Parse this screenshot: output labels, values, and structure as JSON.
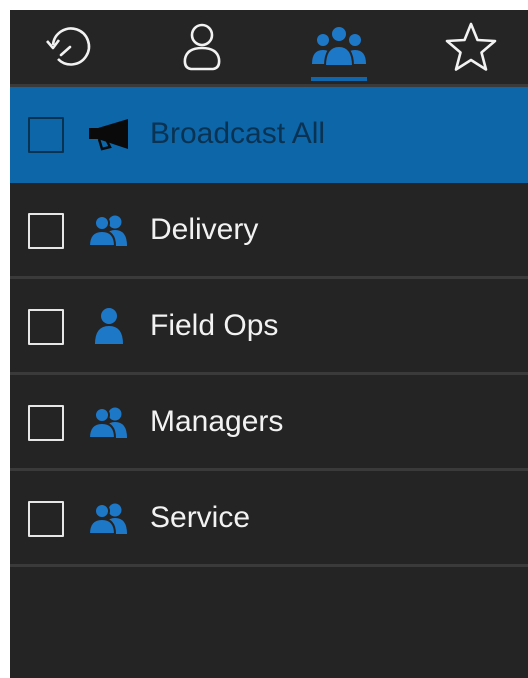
{
  "tabs": [
    {
      "icon": "history-icon",
      "label": "",
      "active": false
    },
    {
      "icon": "contact-icon",
      "label": "",
      "active": false
    },
    {
      "icon": "groups-icon",
      "label": "",
      "active": true
    },
    {
      "icon": "favorites-star-icon",
      "label": "",
      "active": false
    }
  ],
  "list": {
    "items": [
      {
        "label": "Broadcast All",
        "icon": "megaphone-icon",
        "checked": false,
        "selected": true
      },
      {
        "label": "Delivery",
        "icon": "group-icon",
        "checked": false,
        "selected": false
      },
      {
        "label": "Field Ops",
        "icon": "person-icon",
        "checked": false,
        "selected": false
      },
      {
        "label": "Managers",
        "icon": "group-icon",
        "checked": false,
        "selected": false
      },
      {
        "label": "Service",
        "icon": "group-icon",
        "checked": false,
        "selected": false
      }
    ]
  },
  "colors": {
    "background": "#242424",
    "accent": "#0d66a8",
    "icon_blue": "#1e78c8",
    "text": "#f2f2f2",
    "selected_text": "#0a3353"
  }
}
